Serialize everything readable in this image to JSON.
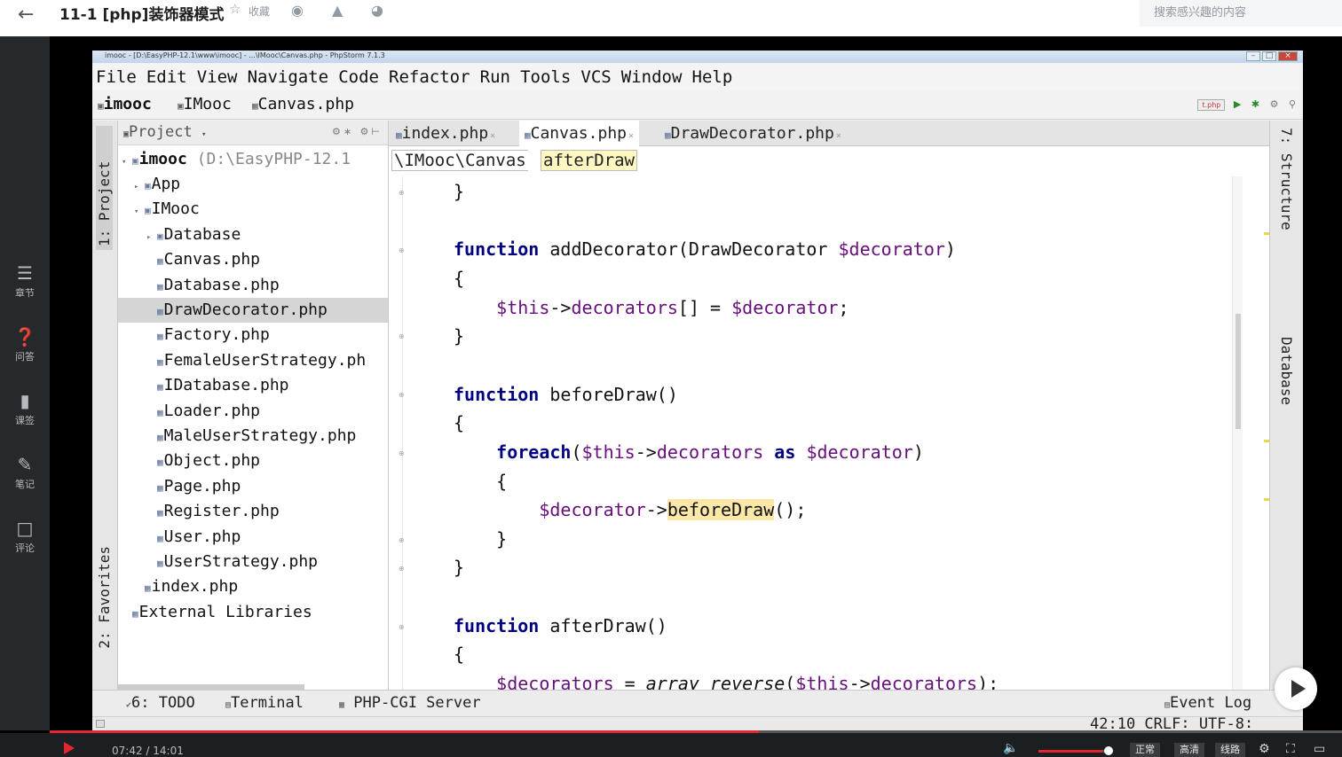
{
  "header": {
    "title": "11-1 [php]装饰器模式",
    "favorite_label": "收藏",
    "search_placeholder": "搜索感兴趣的内容"
  },
  "siderail": [
    {
      "label": "章节",
      "icon": "chapters-icon"
    },
    {
      "label": "问答",
      "icon": "question-icon"
    },
    {
      "label": "课签",
      "icon": "bookmark-icon"
    },
    {
      "label": "笔记",
      "icon": "note-icon"
    },
    {
      "label": "评论",
      "icon": "comment-icon"
    }
  ],
  "ide": {
    "window_title": "imooc - [D:\\EasyPHP-12.1\\www\\imooc] - ...\\IMooc\\Canvas.php - PhpStorm 7.1.3",
    "menu": [
      "File",
      "Edit",
      "View",
      "Navigate",
      "Code",
      "Refactor",
      "Run",
      "Tools",
      "VCS",
      "Window",
      "Help"
    ],
    "breadcrumb": [
      "imooc",
      "IMooc",
      "Canvas.php"
    ],
    "run_config": "t.php",
    "left_tabs": {
      "project": "1: Project",
      "favorites": "2: Favorites"
    },
    "right_tabs": {
      "structure": "7: Structure",
      "database": "Database"
    },
    "project": {
      "title": "Project",
      "root_name": "imooc",
      "root_path": "(D:\\EasyPHP-12.1",
      "tree": [
        {
          "label": "App",
          "kind": "folder",
          "depth": 1,
          "expanded": false
        },
        {
          "label": "IMooc",
          "kind": "folder",
          "depth": 1,
          "expanded": true
        },
        {
          "label": "Database",
          "kind": "folder",
          "depth": 2,
          "expanded": false
        },
        {
          "label": "Canvas.php",
          "kind": "file",
          "depth": 2
        },
        {
          "label": "Database.php",
          "kind": "file",
          "depth": 2
        },
        {
          "label": "DrawDecorator.php",
          "kind": "file",
          "depth": 2,
          "selected": true
        },
        {
          "label": "Factory.php",
          "kind": "file",
          "depth": 2
        },
        {
          "label": "FemaleUserStrategy.ph",
          "kind": "file",
          "depth": 2
        },
        {
          "label": "IDatabase.php",
          "kind": "file",
          "depth": 2
        },
        {
          "label": "Loader.php",
          "kind": "file",
          "depth": 2
        },
        {
          "label": "MaleUserStrategy.php",
          "kind": "file",
          "depth": 2
        },
        {
          "label": "Object.php",
          "kind": "file",
          "depth": 2
        },
        {
          "label": "Page.php",
          "kind": "file",
          "depth": 2
        },
        {
          "label": "Register.php",
          "kind": "file",
          "depth": 2
        },
        {
          "label": "User.php",
          "kind": "file",
          "depth": 2
        },
        {
          "label": "UserStrategy.php",
          "kind": "file",
          "depth": 2
        },
        {
          "label": "index.php",
          "kind": "file",
          "depth": 1
        },
        {
          "label": "External Libraries",
          "kind": "library",
          "depth": 0
        }
      ]
    },
    "tabs": [
      {
        "label": "index.php",
        "active": false
      },
      {
        "label": "Canvas.php",
        "active": true
      },
      {
        "label": "DrawDecorator.php",
        "active": false
      }
    ],
    "editor_crumb": {
      "namespace": "\\IMooc\\Canvas",
      "method": "afterDraw"
    },
    "code": [
      "}",
      "",
      "function addDecorator(DrawDecorator $decorator)",
      "{",
      "    $this->decorators[] = $decorator;",
      "}",
      "",
      "function beforeDraw()",
      "{",
      "    foreach($this->decorators as $decorator)",
      "    {",
      "        $decorator->beforeDraw();",
      "    }",
      "}",
      "",
      "function afterDraw()",
      "{",
      "    $decorators = array_reverse($this->decorators);"
    ],
    "bottom_tabs": [
      "6: TODO",
      "Terminal",
      "PHP-CGI Server"
    ],
    "event_log": "Event Log",
    "status": "42:10  CRLF∶ UTF-8∶"
  },
  "player": {
    "current_time": "07:42",
    "duration": "14:01",
    "time_display": "07:42 / 14:01",
    "progress": 0.549,
    "volume": 0.9,
    "buttons": [
      "正常",
      "高清",
      "线路"
    ]
  }
}
